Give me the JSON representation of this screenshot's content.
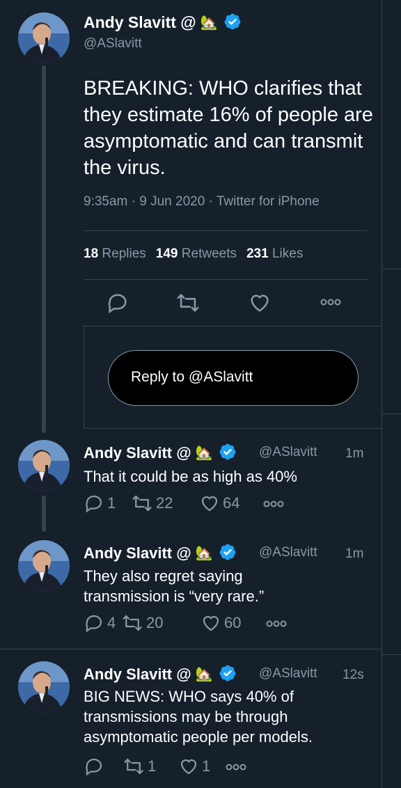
{
  "main_tweet": {
    "name": "Andy Slavitt @",
    "emoji": "🏡",
    "handle": "@ASlavitt",
    "text": "BREAKING: WHO clarifies that they estimate 16% of people are asymptomatic and can transmit the virus.",
    "meta": "9:35am · 9 Jun 2020 · Twitter for iPhone",
    "stats": {
      "replies_count": "18",
      "replies_label": "Replies",
      "retweets_count": "149",
      "retweets_label": "Retweets",
      "likes_count": "231",
      "likes_label": "Likes"
    },
    "icons": [
      "reply-icon",
      "retweet-icon",
      "like-icon",
      "more-icon"
    ]
  },
  "reply_prompt": "Reply to @ASlavitt",
  "replies": [
    {
      "name": "Andy Slavitt @",
      "emoji": "🏡",
      "handle": "@ASlavitt",
      "time": "1m",
      "lines": [
        "That it could be as high as 40%"
      ],
      "reply_count": "1",
      "retweet_count": "22",
      "like_count": "64"
    },
    {
      "name": "Andy Slavitt @",
      "emoji": "🏡",
      "handle": "@ASlavitt",
      "time": "1m",
      "lines": [
        "They also regret saying",
        "transmission is “very rare.”"
      ],
      "reply_count": "4",
      "retweet_count": "20",
      "like_count": "60"
    },
    {
      "name": "Andy Slavitt @",
      "emoji": "🏡",
      "handle": "@ASlavitt",
      "time": "12s",
      "lines": [
        "BIG NEWS: WHO says 40% of",
        "transmissions may be through",
        "asymptomatic people per models."
      ],
      "reply_count": "",
      "retweet_count": "1",
      "like_count": "1"
    }
  ],
  "colors": {
    "background": "#15202b",
    "border": "#38444d",
    "muted": "#8899a6",
    "verified": "#1da1f2"
  }
}
